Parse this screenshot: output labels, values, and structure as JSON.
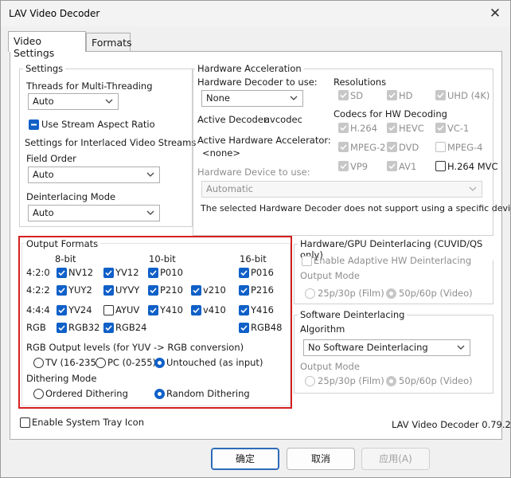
{
  "window": {
    "title": "LAV Video Decoder"
  },
  "tabs": [
    "Video Settings",
    "Formats"
  ],
  "settings": {
    "title": "Settings",
    "threads_label": "Threads for Multi-Threading",
    "threads_value": "Auto",
    "stream_aspect": "Use Stream Aspect Ratio",
    "interlaced_title": "Settings for Interlaced Video Streams",
    "field_order_label": "Field Order",
    "field_order_value": "Auto",
    "deint_mode_label": "Deinterlacing Mode",
    "deint_mode_value": "Auto"
  },
  "hwaccel": {
    "title": "Hardware Acceleration",
    "decoder_label": "Hardware Decoder to use:",
    "decoder_value": "None",
    "active_decoder_label": "Active Decoder:",
    "active_decoder_value": "avcodec",
    "active_accel_label": "Active Hardware Accelerator:",
    "active_accel_value": "<none>",
    "device_label": "Hardware Device to use:",
    "device_value": "Automatic",
    "note": "The selected Hardware Decoder does not support using a specific device.",
    "resolutions_title": "Resolutions",
    "resolutions": [
      "SD",
      "HD",
      "UHD (4K)"
    ],
    "codecs_title": "Codecs for HW Decoding",
    "codecs": [
      "H.264",
      "HEVC",
      "VC-1",
      "MPEG-2",
      "DVD",
      "MPEG-4",
      "VP9",
      "AV1",
      "H.264 MVC"
    ]
  },
  "output": {
    "title": "Output Formats",
    "col_headers": [
      "8-bit",
      "10-bit",
      "16-bit"
    ],
    "row_labels": [
      "4:2:0",
      "4:2:2",
      "4:4:4",
      "RGB"
    ],
    "formats": {
      "nv12": "NV12",
      "yv12": "YV12",
      "p010": "P010",
      "p016": "P016",
      "yuy2": "YUY2",
      "uyvy": "UYVY",
      "p210": "P210",
      "v210": "v210",
      "p216": "P216",
      "yv24": "YV24",
      "ayuv": "AYUV",
      "y410": "Y410",
      "v410": "v410",
      "y416": "Y416",
      "rgb32": "RGB32",
      "rgb24": "RGB24",
      "rgb48": "RGB48"
    },
    "rgb_levels_title": "RGB Output levels (for YUV -> RGB conversion)",
    "rgb_levels": [
      "TV (16-235)",
      "PC (0-255)",
      "Untouched (as input)"
    ],
    "dither_title": "Dithering Mode",
    "dither": [
      "Ordered Dithering",
      "Random Dithering"
    ]
  },
  "hw_deint": {
    "title": "Hardware/GPU Deinterlacing (CUVID/QS only)",
    "adaptive": "Enable Adaptive HW Deinterlacing",
    "output_mode_label": "Output Mode",
    "modes": [
      "25p/30p (Film)",
      "50p/60p (Video)"
    ]
  },
  "sw_deint": {
    "title": "Software Deinterlacing",
    "algorithm_label": "Algorithm",
    "algorithm_value": "No Software Deinterlacing",
    "output_mode_label": "Output Mode",
    "modes": [
      "25p/30p (Film)",
      "50p/60p (Video)"
    ]
  },
  "tray_icon": "Enable System Tray Icon",
  "version": "LAV Video Decoder 0.79.2",
  "buttons": {
    "ok": "确定",
    "cancel": "取消",
    "apply": "应用(A)"
  },
  "colors": {
    "accent": "#1060c8",
    "highlight_border": "#d42020"
  }
}
